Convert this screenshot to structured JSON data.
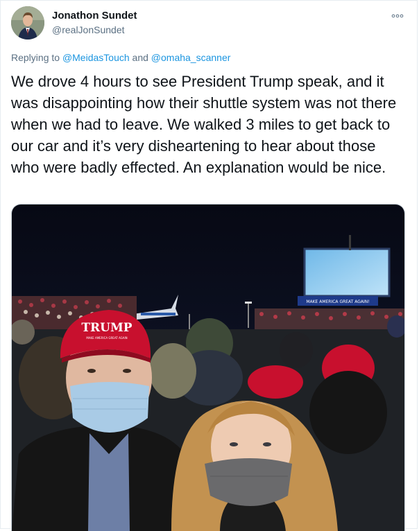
{
  "author": {
    "name": "Jonathon Sundet",
    "handle": "@realJonSundet"
  },
  "more_icon": "more-options-icon",
  "reply": {
    "prefix": "Replying to",
    "mention_1": "@MeidasTouch",
    "connector": "and",
    "mention_2": "@omaha_scanner"
  },
  "tweet_text": "We drove 4 hours to see President Trump speak, and it was disappointing how their shuttle system was not there when we had to leave. We walked 3 miles to get back to our car and it’s very disheartening to hear about those who were badly effected. An explanation would be nice.",
  "photo": {
    "hat_text": "TRUMP",
    "hat_subtext": "MAKE AMERICA GREAT AGAIN",
    "screen_banner": "MAKE AMERICA GREAT AGAIN!"
  },
  "colors": {
    "link": "#1b95e0",
    "secondary_text": "#5b7083",
    "night_sky": "#0b0e1c",
    "hat_red": "#c8102e"
  }
}
